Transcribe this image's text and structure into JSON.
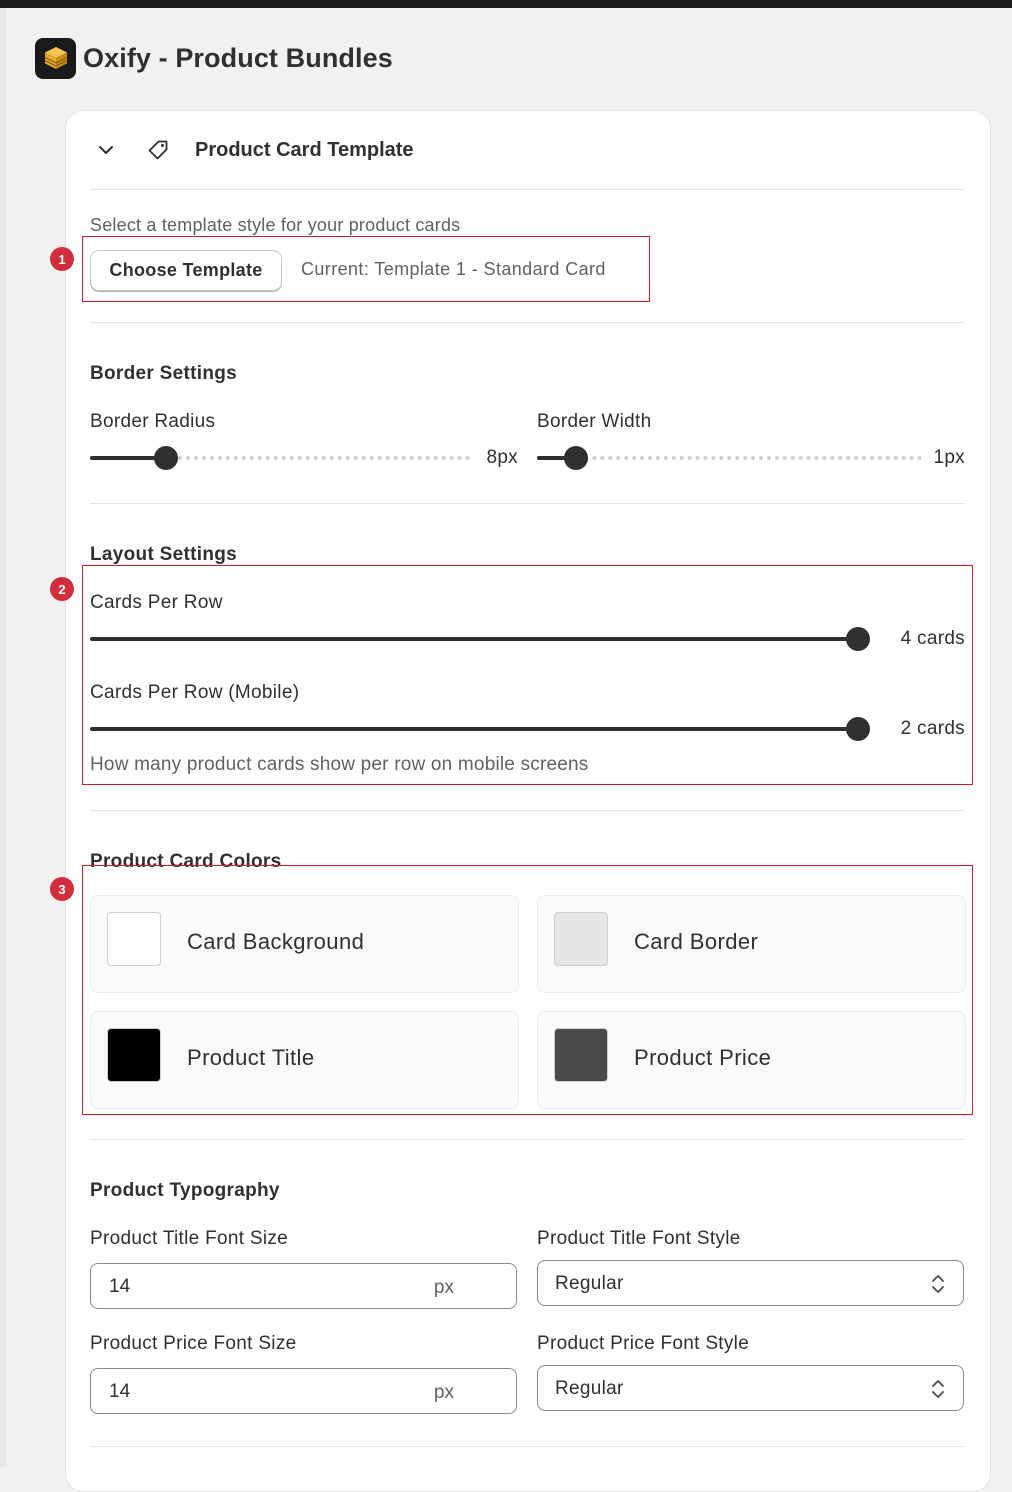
{
  "app": {
    "title": "Oxify - Product Bundles",
    "logo_icon": "stacked-boxes-icon"
  },
  "section": {
    "title": "Product Card Template",
    "collapse_icon": "chevron-down-icon",
    "section_icon": "tag-icon"
  },
  "template": {
    "hint": "Select a template style for your product cards",
    "choose_label": "Choose Template",
    "current": "Current: Template 1 - Standard Card"
  },
  "annotations": [
    "1",
    "2",
    "3"
  ],
  "border_settings": {
    "heading": "Border Settings",
    "radius": {
      "label": "Border Radius",
      "value_text": "8px",
      "value": 8,
      "min": 0,
      "max": 40
    },
    "width": {
      "label": "Border Width",
      "value_text": "1px",
      "value": 1,
      "min": 0,
      "max": 10
    }
  },
  "layout_settings": {
    "heading": "Layout Settings",
    "cards_per_row": {
      "label": "Cards Per Row",
      "value_text": "4 cards",
      "value": 4,
      "min": 1,
      "max": 4
    },
    "cards_per_row_mobile": {
      "label": "Cards Per Row (Mobile)",
      "value_text": "2 cards",
      "value": 2,
      "min": 1,
      "max": 2
    },
    "help": "How many product cards show per row on mobile screens"
  },
  "colors": {
    "heading": "Product Card Colors",
    "items": [
      {
        "label": "Card Background",
        "color": "#ffffff"
      },
      {
        "label": "Card Border",
        "color": "#e6e6e6"
      },
      {
        "label": "Product Title",
        "color": "#000000"
      },
      {
        "label": "Product Price",
        "color": "#4a4a4a"
      }
    ]
  },
  "typography": {
    "heading": "Product Typography",
    "title_size": {
      "label": "Product Title Font Size",
      "value": "14",
      "suffix": "px"
    },
    "title_style": {
      "label": "Product Title Font Style",
      "value": "Regular"
    },
    "price_size": {
      "label": "Product Price Font Size",
      "value": "14",
      "suffix": "px"
    },
    "price_style": {
      "label": "Product Price Font Style",
      "value": "Regular"
    }
  }
}
